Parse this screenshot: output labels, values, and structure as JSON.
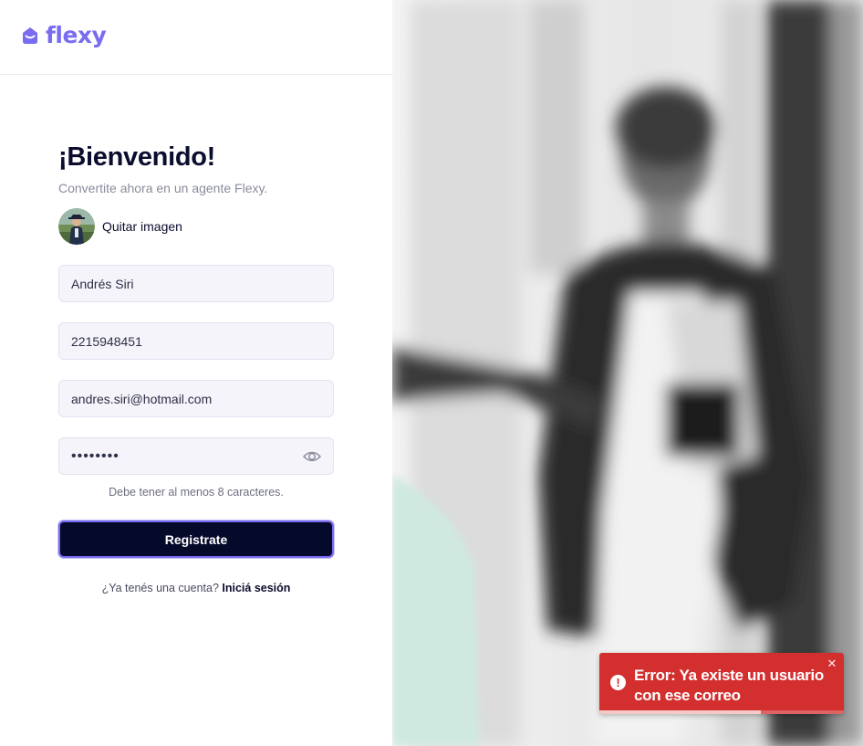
{
  "brand": {
    "name": "flexy",
    "logo_color": "#7a6cf0"
  },
  "form": {
    "title": "¡Bienvenido!",
    "subtitle": "Convertite ahora en un agente Flexy.",
    "remove_image_label": "Quitar imagen",
    "name_value": "Andrés Siri",
    "phone_value": "2215948451",
    "email_value": "andres.siri@hotmail.com",
    "password_value": "••••••••",
    "password_hint": "Debe tener al menos 8 caracteres.",
    "submit_label": "Registrate",
    "login_prompt": "¿Ya tenés una cuenta?",
    "login_link": "Iniciá sesión"
  },
  "toast": {
    "message": "Error: Ya existe un usuario con ese correo",
    "icon": "!",
    "close": "✕",
    "progress": 0.66,
    "color": "#d32f2f"
  },
  "colors": {
    "accent": "#7a6cf0",
    "button_bg": "#050a2b",
    "mint": "#cfe9e1"
  },
  "icons": [
    "flexy-logo-icon",
    "eye-icon",
    "error-icon",
    "close-icon"
  ]
}
